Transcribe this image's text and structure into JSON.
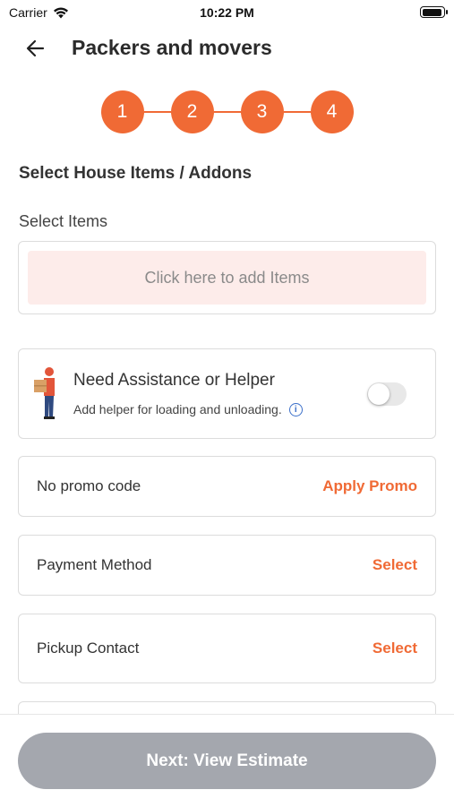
{
  "status_bar": {
    "carrier": "Carrier",
    "time": "10:22 PM"
  },
  "header": {
    "title": "Packers and movers"
  },
  "stepper": {
    "steps": [
      "1",
      "2",
      "3",
      "4"
    ],
    "color": "#f06a35"
  },
  "select_section": {
    "title": "Select House Items / Addons",
    "items_label": "Select Items",
    "add_items_text": "Click here to add Items"
  },
  "assistance": {
    "title": "Need Assistance or Helper",
    "subtitle": "Add helper for loading and unloading.",
    "toggle_on": false
  },
  "promo": {
    "label": "No promo code",
    "action": "Apply Promo"
  },
  "payment": {
    "label": "Payment Method",
    "action": "Select"
  },
  "pickup": {
    "label": "Pickup Contact",
    "action": "Select"
  },
  "footer": {
    "next_label": "Next: View Estimate"
  },
  "colors": {
    "accent": "#f06a35",
    "disabled_button": "#a4a7ae",
    "add_items_bg": "#fdecea"
  }
}
